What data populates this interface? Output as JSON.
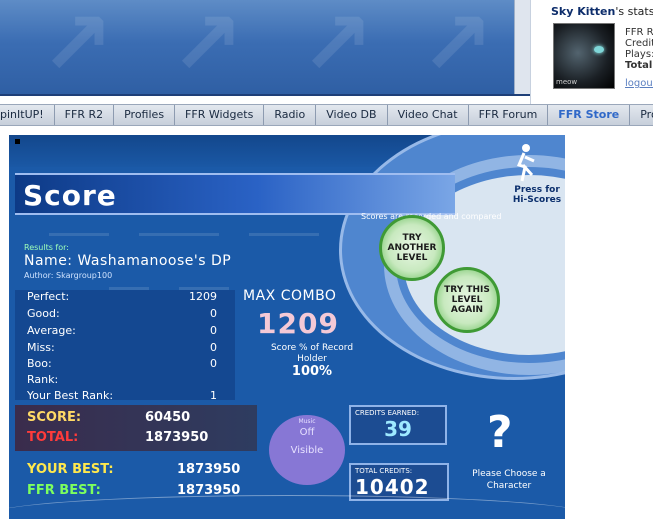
{
  "stats": {
    "title_name": "Sky Kitten",
    "title_rest": "'s stats:",
    "avatar_caption": "meow",
    "lines": [
      "FFR R",
      "Credit",
      "Plays:",
      "Total"
    ],
    "logout": "logout"
  },
  "nav": {
    "items": [
      {
        "label": "pinItUP!",
        "active": false
      },
      {
        "label": "FFR R2",
        "active": false
      },
      {
        "label": "Profiles",
        "active": false
      },
      {
        "label": "FFR Widgets",
        "active": false
      },
      {
        "label": "Radio",
        "active": false
      },
      {
        "label": "Video DB",
        "active": false
      },
      {
        "label": "Video Chat",
        "active": false
      },
      {
        "label": "FFR Forum",
        "active": false
      },
      {
        "label": "FFR Store",
        "active": true
      },
      {
        "label": "Profile Setting",
        "active": false
      }
    ]
  },
  "game": {
    "score_title": "Score",
    "hiscore_label": "Press for Hi-Scores",
    "recorded_text": "Scores are recorded and compared",
    "try_another": "TRY ANOTHER LEVEL",
    "try_again": "TRY THIS LEVEL AGAIN",
    "results_for": "Results for:",
    "name_line": "Name: Washamanoose's DP",
    "author_line": "Author: Skargroup100",
    "stats": [
      {
        "label": "Perfect:",
        "value": "1209",
        "box": false
      },
      {
        "label": "Good:",
        "value": "0",
        "box": true
      },
      {
        "label": "Average:",
        "value": "0",
        "box": true
      },
      {
        "label": "Miss:",
        "value": "0",
        "box": true
      },
      {
        "label": "Boo:",
        "value": "0",
        "box": true
      },
      {
        "label": "Rank:",
        "value": "",
        "box": false
      },
      {
        "label": "Your Best Rank:",
        "value": "1",
        "box": false
      }
    ],
    "max_combo_label": "MAX COMBO",
    "max_combo_value": "1209",
    "record_line": "Score % of Record Holder",
    "record_pct": "100%",
    "score_label": "SCORE:",
    "score_value": "60450",
    "total_label": "TOTAL:",
    "total_value": "1873950",
    "music_label": "Music",
    "music_off": "Off",
    "music_visible": "Visible",
    "credits_caption": "CREDITS EARNED:",
    "credits_value": "39",
    "total_credits_caption": "TOTAL CREDITS:",
    "total_credits_value": "10402",
    "your_best_label": "YOUR BEST:",
    "your_best_value": "1873950",
    "ffr_best_label": "FFR BEST:",
    "ffr_best_value": "1873950",
    "question": "?",
    "choose_text": "Please Choose a Character"
  },
  "colors": {
    "score_label": "#ffd966",
    "total_label": "#ff3b3b",
    "your_best_label": "#ffe84d",
    "ffr_best_label": "#7dff5e",
    "nav_active": "#2f68c8"
  }
}
